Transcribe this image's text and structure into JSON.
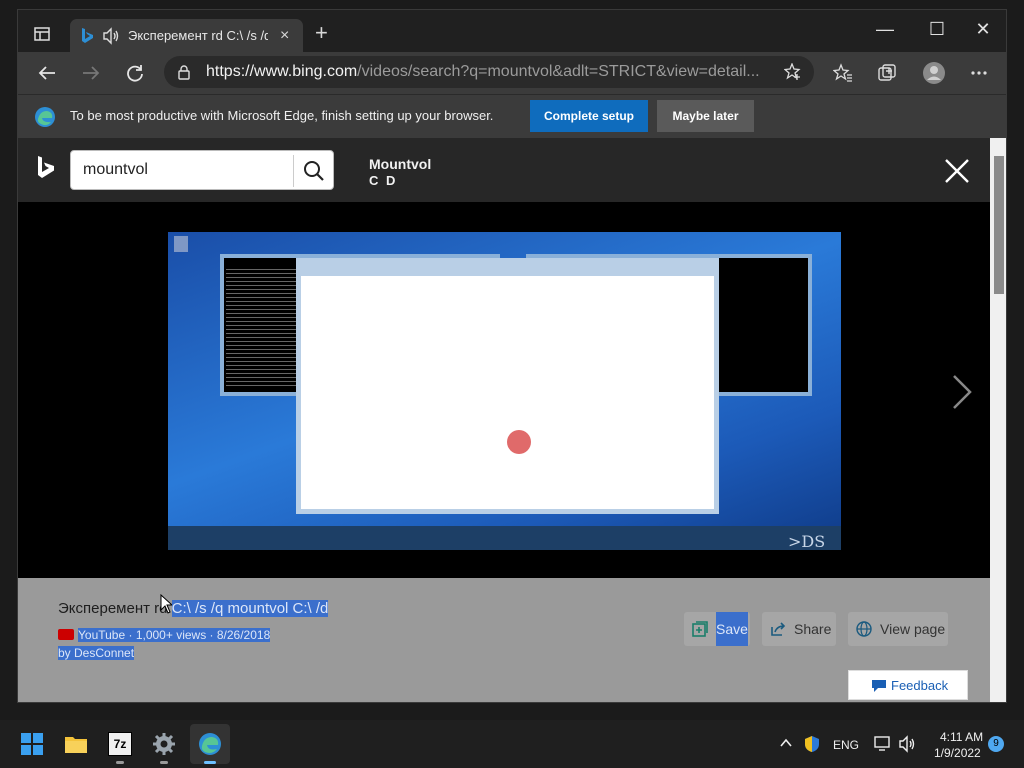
{
  "browser": {
    "tab": {
      "title": "Эксперемент rd C:\\ /s /q m",
      "close": "×"
    },
    "new_tab": "+",
    "url_host": "https://www.bing.com",
    "url_rest": "/videos/search?q=mountvol&adlt=STRICT&view=detail..."
  },
  "window_controls": {
    "minimize": "—",
    "maximize": "☐",
    "close": "✕"
  },
  "infobar": {
    "message": "To be most productive with Microsoft Edge, finish setting up your browser.",
    "complete_setup": "Complete setup",
    "maybe_later": "Maybe later"
  },
  "bing": {
    "search_value": "mountvol",
    "video_title": "Mountvol",
    "video_subtitle": "C D"
  },
  "player": {
    "watermark": ">DS"
  },
  "details": {
    "title_plain": "Эксперемент rd ",
    "title_selected": "C:\\ /s /q mountvol C:\\ /d",
    "meta": "YouTube · 1,000+ views · 8/26/2018",
    "author": "by DesConnet",
    "actions": {
      "save": "Save",
      "share": "Share",
      "view_page": "View page"
    },
    "feedback": "Feedback"
  },
  "taskbar": {
    "lang": "ENG",
    "time": "4:11 AM",
    "date": "1/9/2022",
    "notifications": "9",
    "app_7z": "7z"
  },
  "colors": {
    "accent": "#0f6cbd",
    "selection": "#3b6fcc",
    "edge_blue": "#2d8fd5"
  }
}
